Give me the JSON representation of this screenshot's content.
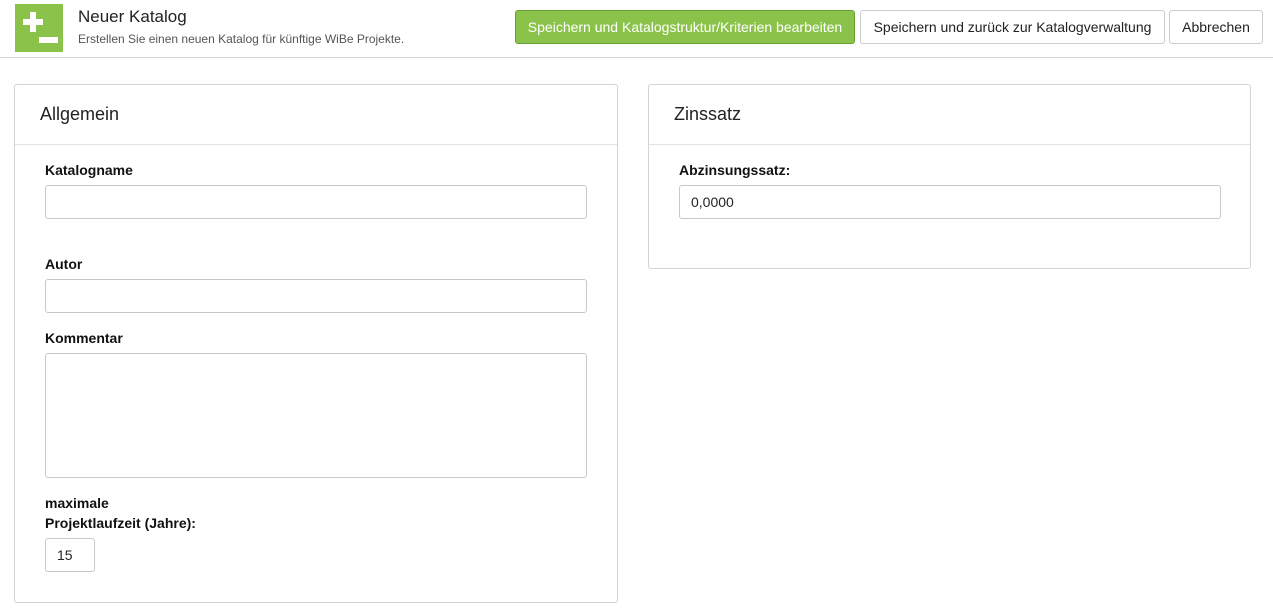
{
  "header": {
    "icon": "plus-minus-icon",
    "accent_color": "#8bc34a",
    "title": "Neuer Katalog",
    "subtitle": "Erstellen Sie einen neuen Katalog für künftige WiBe Projekte.",
    "buttons": {
      "save_edit": "Speichern und Katalogstruktur/Kriterien bearbeiten",
      "save_back": "Speichern und zurück zur Katalogverwaltung",
      "cancel": "Abbrechen"
    }
  },
  "general": {
    "heading": "Allgemein",
    "catalog_name": {
      "label": "Katalogname",
      "value": ""
    },
    "author": {
      "label": "Autor",
      "value": ""
    },
    "comment": {
      "label": "Kommentar",
      "value": ""
    },
    "duration": {
      "label_line1": "maximale",
      "label_line2": "Projektlaufzeit (Jahre):",
      "value": "15"
    }
  },
  "interest": {
    "heading": "Zinssatz",
    "discount_rate": {
      "label": "Abzinsungssatz:",
      "value": "0,0000"
    }
  }
}
